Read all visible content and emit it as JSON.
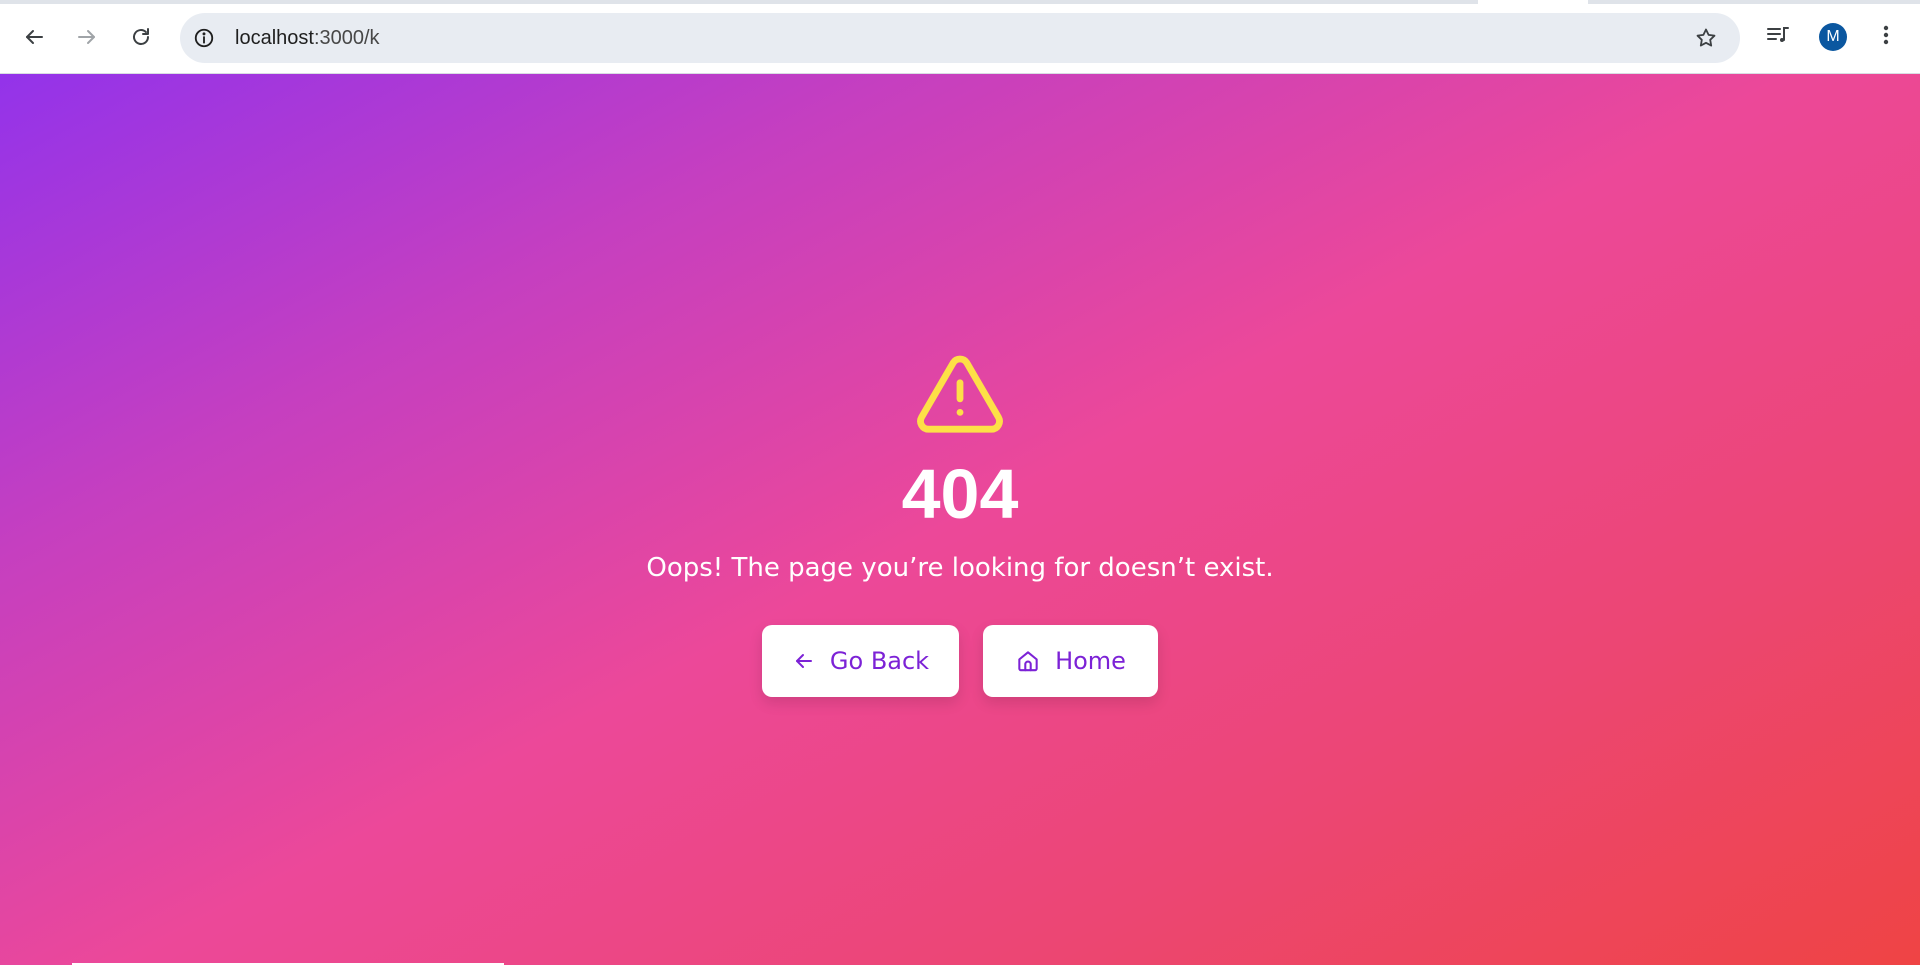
{
  "browser": {
    "url_host": "localhost",
    "url_rest": ":3000/k",
    "profile_initial": "M"
  },
  "page": {
    "error_code": "404",
    "message": "Oops! The page you’re looking for doesn’t exist.",
    "buttons": {
      "back_label": "Go Back",
      "home_label": "Home"
    }
  },
  "colors": {
    "gradient_start": "#9333ea",
    "gradient_mid": "#ec4899",
    "gradient_end": "#ef4444",
    "warning_icon": "#fde047",
    "button_text": "#7c22d6",
    "avatar_bg": "#0b57a0"
  },
  "icons": {
    "back": "arrow-left-icon",
    "forward": "arrow-right-icon",
    "reload": "reload-icon",
    "site_info": "info-icon",
    "bookmark": "star-icon",
    "media": "media-queue-icon",
    "menu": "kebab-menu-icon",
    "warning": "warning-triangle-icon",
    "go_back": "arrow-left-icon",
    "home": "home-icon"
  }
}
